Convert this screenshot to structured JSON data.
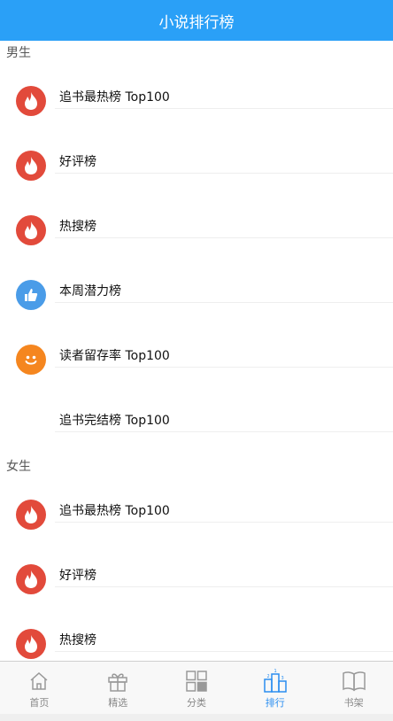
{
  "header": {
    "title": "小说排行榜"
  },
  "sections": [
    {
      "title": "男生",
      "items": [
        {
          "label": "追书最热榜 Top100",
          "icon": "fire-icon"
        },
        {
          "label": "好评榜",
          "icon": "fire-icon"
        },
        {
          "label": "热搜榜",
          "icon": "fire-icon"
        },
        {
          "label": "本周潜力榜",
          "icon": "thumbs-up-icon"
        },
        {
          "label": "读者留存率 Top100",
          "icon": "smile-icon"
        },
        {
          "label": "追书完结榜 Top100",
          "icon": ""
        }
      ]
    },
    {
      "title": "女生",
      "items": [
        {
          "label": "追书最热榜 Top100",
          "icon": "fire-icon"
        },
        {
          "label": "好评榜",
          "icon": "fire-icon"
        },
        {
          "label": "热搜榜",
          "icon": "fire-icon"
        }
      ]
    }
  ],
  "tabbar": {
    "items": [
      {
        "label": "首页",
        "icon": "home-icon",
        "active": false
      },
      {
        "label": "精选",
        "icon": "gift-icon",
        "active": false
      },
      {
        "label": "分类",
        "icon": "grid-icon",
        "active": false
      },
      {
        "label": "排行",
        "icon": "podium-icon",
        "active": true
      },
      {
        "label": "书架",
        "icon": "book-icon",
        "active": false
      }
    ]
  },
  "colors": {
    "header": "#2aa0f7",
    "fire": "#e24a3b",
    "thumb": "#4a9ce8",
    "smile": "#f5861f",
    "active_tab": "#2a8ef0"
  }
}
